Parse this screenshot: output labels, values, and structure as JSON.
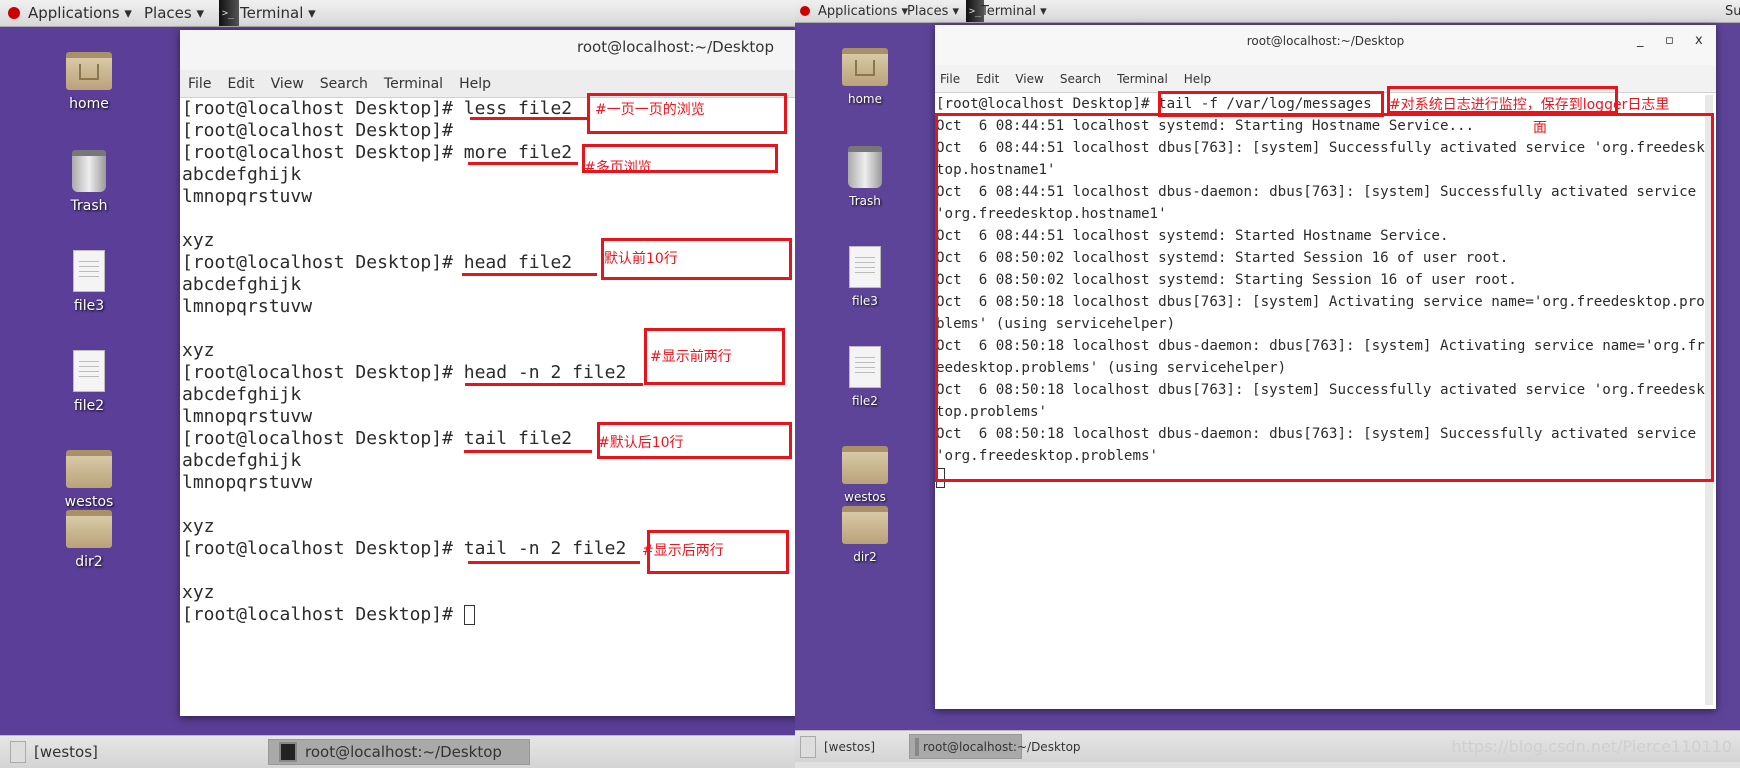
{
  "left": {
    "topbar": {
      "applications": "Applications ▾",
      "places": "Places ▾",
      "terminal": "Terminal ▾"
    },
    "desktop_icons": [
      "home",
      "Trash",
      "file3",
      "file2",
      "westos",
      "dir2"
    ],
    "window": {
      "title": "root@localhost:~/Desktop",
      "menu": [
        "File",
        "Edit",
        "View",
        "Search",
        "Terminal",
        "Help"
      ],
      "lines": [
        "[root@localhost Desktop]# less file2",
        "[root@localhost Desktop]# ",
        "[root@localhost Desktop]# more file2",
        "abcdefghijk",
        "lmnopqrstuvw",
        "",
        "xyz",
        "[root@localhost Desktop]# head file2",
        "abcdefghijk",
        "lmnopqrstuvw",
        "",
        "xyz",
        "[root@localhost Desktop]# head -n 2 file2",
        "abcdefghijk",
        "lmnopqrstuvw",
        "[root@localhost Desktop]# tail file2",
        "abcdefghijk",
        "lmnopqrstuvw",
        "",
        "xyz",
        "[root@localhost Desktop]# tail -n 2 file2",
        "",
        "xyz",
        "[root@localhost Desktop]# "
      ]
    },
    "annotations": [
      "#一页一页的浏览",
      "#多页浏览",
      "默认前10行",
      "#显示前两行",
      "#默认后10行",
      "#显示后两行"
    ],
    "taskbar": {
      "workspace": "[westos]",
      "active_window": "root@localhost:~/Desktop"
    }
  },
  "right": {
    "topbar": {
      "applications": "Applications ▾",
      "places": "Places ▾",
      "terminal": "Terminal ▾",
      "clock_partial": "Su"
    },
    "desktop_icons": [
      "home",
      "Trash",
      "file3",
      "file2",
      "westos",
      "dir2"
    ],
    "window": {
      "title": "root@localhost:~/Desktop",
      "controls": {
        "minimize": "_",
        "maximize": "▫",
        "close": "x"
      },
      "menu": [
        "File",
        "Edit",
        "View",
        "Search",
        "Terminal",
        "Help"
      ],
      "lines": [
        "[root@localhost Desktop]# tail -f /var/log/messages",
        "Oct  6 08:44:51 localhost systemd: Starting Hostname Service...",
        "Oct  6 08:44:51 localhost dbus[763]: [system] Successfully activated service 'org.freedesk",
        "top.hostname1'",
        "Oct  6 08:44:51 localhost dbus-daemon: dbus[763]: [system] Successfully activated service",
        "'org.freedesktop.hostname1'",
        "Oct  6 08:44:51 localhost systemd: Started Hostname Service.",
        "Oct  6 08:50:02 localhost systemd: Started Session 16 of user root.",
        "Oct  6 08:50:02 localhost systemd: Starting Session 16 of user root.",
        "Oct  6 08:50:18 localhost dbus[763]: [system] Activating service name='org.freedesktop.pro",
        "blems' (using servicehelper)",
        "Oct  6 08:50:18 localhost dbus-daemon: dbus[763]: [system] Activating service name='org.fr",
        "eedesktop.problems' (using servicehelper)",
        "Oct  6 08:50:18 localhost dbus[763]: [system] Successfully activated service 'org.freedesk",
        "top.problems'",
        "Oct  6 08:50:18 localhost dbus-daemon: dbus[763]: [system] Successfully activated service",
        "'org.freedesktop.problems'",
        ""
      ]
    },
    "annotation": "#对系统日志进行监控，保存到logger日志里",
    "annotation_wrap": "面",
    "taskbar": {
      "workspace": "[westos]",
      "active_window": "root@localhost:~/Desktop"
    },
    "watermark": "https://blog.csdn.net/Pierce110110"
  },
  "colors": {
    "desktop": "#5a3e97",
    "annotation": "#e8141c"
  }
}
